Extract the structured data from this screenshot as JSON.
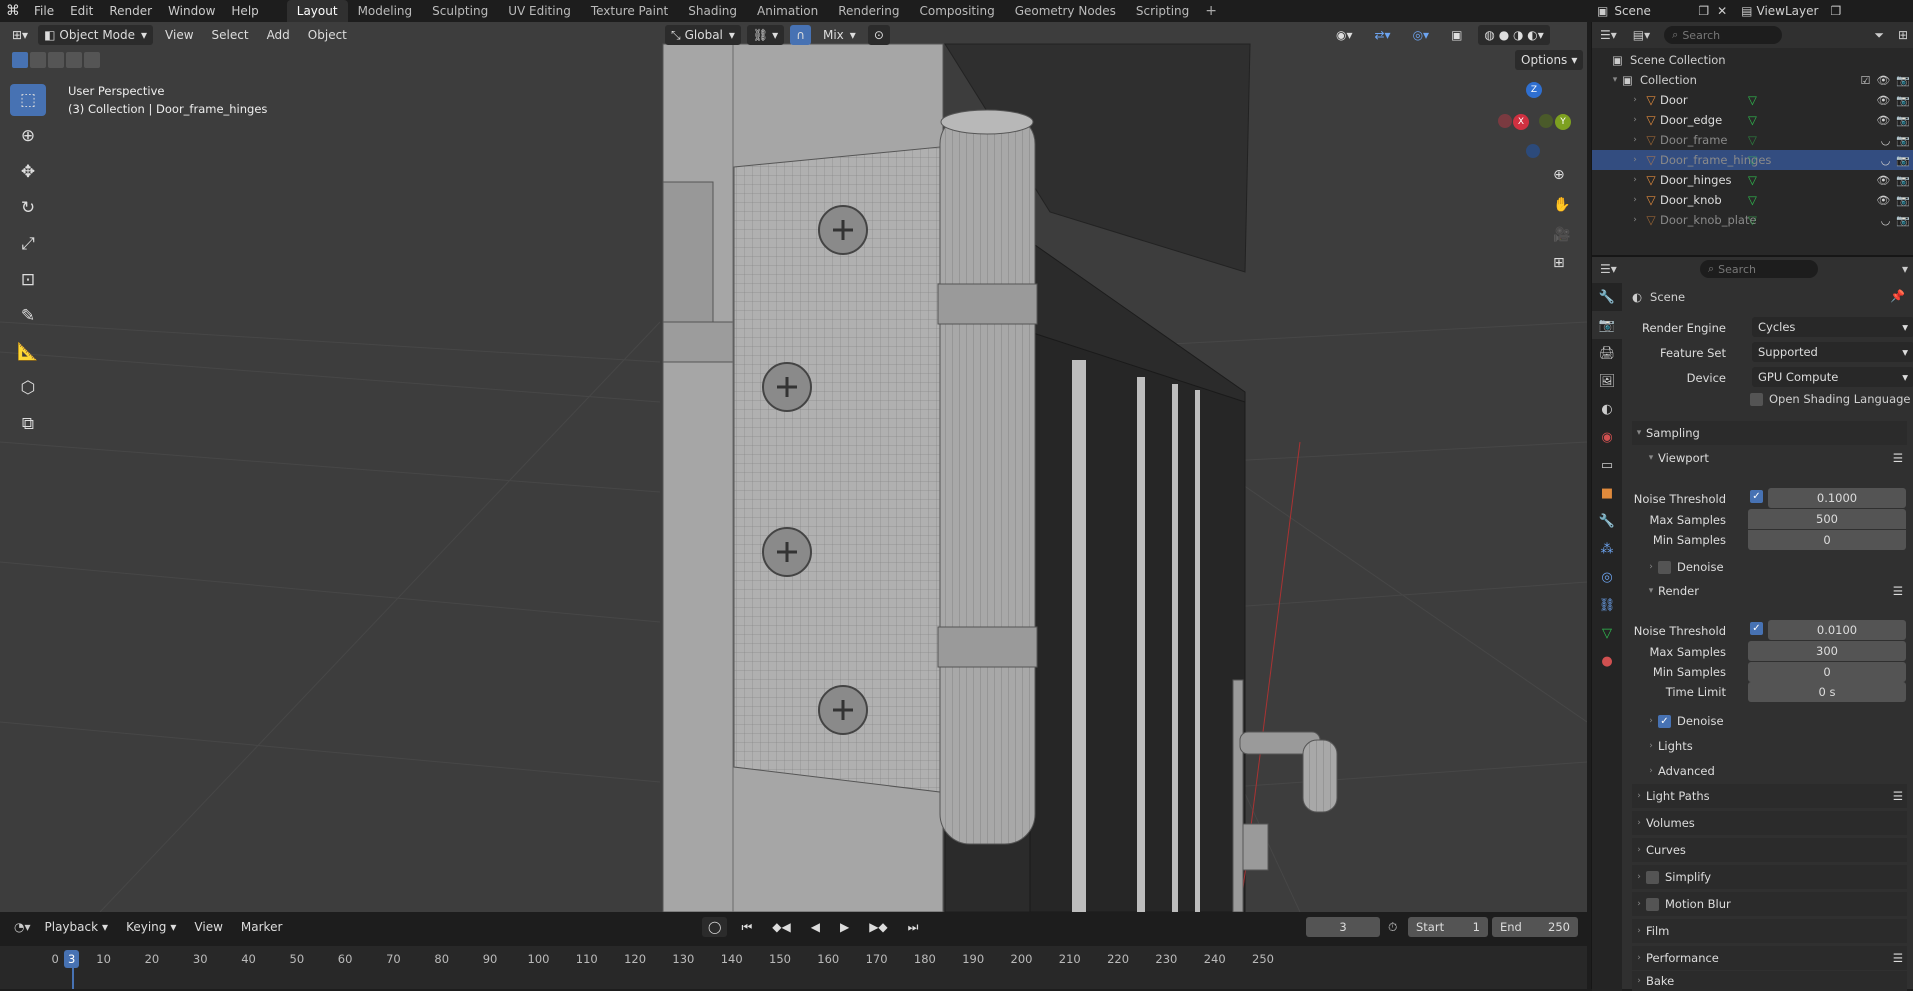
{
  "menu": {
    "file": "File",
    "edit": "Edit",
    "render": "Render",
    "window": "Window",
    "help": "Help"
  },
  "workspaces": [
    "Layout",
    "Modeling",
    "Sculpting",
    "UV Editing",
    "Texture Paint",
    "Shading",
    "Animation",
    "Rendering",
    "Compositing",
    "Geometry Nodes",
    "Scripting"
  ],
  "top_right": {
    "scene": "Scene",
    "viewlayer": "ViewLayer"
  },
  "viewport": {
    "mode": "Object Mode",
    "view": "View",
    "select": "Select",
    "add": "Add",
    "object": "Object",
    "transform": "Global",
    "shading_mix": "Mix",
    "options": "Options",
    "perspective": "User Perspective",
    "context": "(3) Collection | Door_frame_hinges",
    "gizmo": {
      "z": "Z",
      "x": "X",
      "y": "Y"
    }
  },
  "outliner": {
    "search_placeholder": "Search",
    "scene_collection": "Scene Collection",
    "collection": "Collection",
    "objects": [
      {
        "name": "Door",
        "dim": false,
        "selected": false
      },
      {
        "name": "Door_edge",
        "dim": false,
        "selected": false
      },
      {
        "name": "Door_frame",
        "dim": true,
        "selected": false
      },
      {
        "name": "Door_frame_hinges",
        "dim": true,
        "selected": true
      },
      {
        "name": "Door_hinges",
        "dim": false,
        "selected": false
      },
      {
        "name": "Door_knob",
        "dim": false,
        "selected": false
      },
      {
        "name": "Door_knob_plate",
        "dim": true,
        "selected": false
      }
    ]
  },
  "properties": {
    "search_placeholder": "Search",
    "context": "Scene",
    "render_engine_label": "Render Engine",
    "render_engine": "Cycles",
    "feature_set_label": "Feature Set",
    "feature_set": "Supported",
    "device_label": "Device",
    "device": "GPU Compute",
    "osl": "Open Shading Language",
    "sampling": "Sampling",
    "viewport_sub": "Viewport",
    "noise_threshold": "Noise Threshold",
    "vp_noise": "0.1000",
    "max_samples": "Max Samples",
    "vp_max": "500",
    "min_samples": "Min Samples",
    "vp_min": "0",
    "denoise": "Denoise",
    "render_sub": "Render",
    "r_noise": "0.0100",
    "r_max": "300",
    "r_min": "0",
    "time_limit": "Time Limit",
    "r_time": "0 s",
    "lights": "Lights",
    "advanced": "Advanced",
    "light_paths": "Light Paths",
    "volumes": "Volumes",
    "curves": "Curves",
    "simplify": "Simplify",
    "motion_blur": "Motion Blur",
    "film": "Film",
    "performance": "Performance",
    "bake": "Bake"
  },
  "timeline": {
    "playback": "Playback",
    "keying": "Keying",
    "view": "View",
    "marker": "Marker",
    "current_frame": "3",
    "start_label": "Start",
    "start": "1",
    "end_label": "End",
    "end": "250",
    "ruler_current": "3",
    "ticks": [
      "0",
      "10",
      "20",
      "30",
      "40",
      "50",
      "60",
      "70",
      "80",
      "90",
      "100",
      "110",
      "120",
      "130",
      "140",
      "150",
      "160",
      "170",
      "180",
      "190",
      "200",
      "210",
      "220",
      "230",
      "240",
      "250"
    ]
  }
}
